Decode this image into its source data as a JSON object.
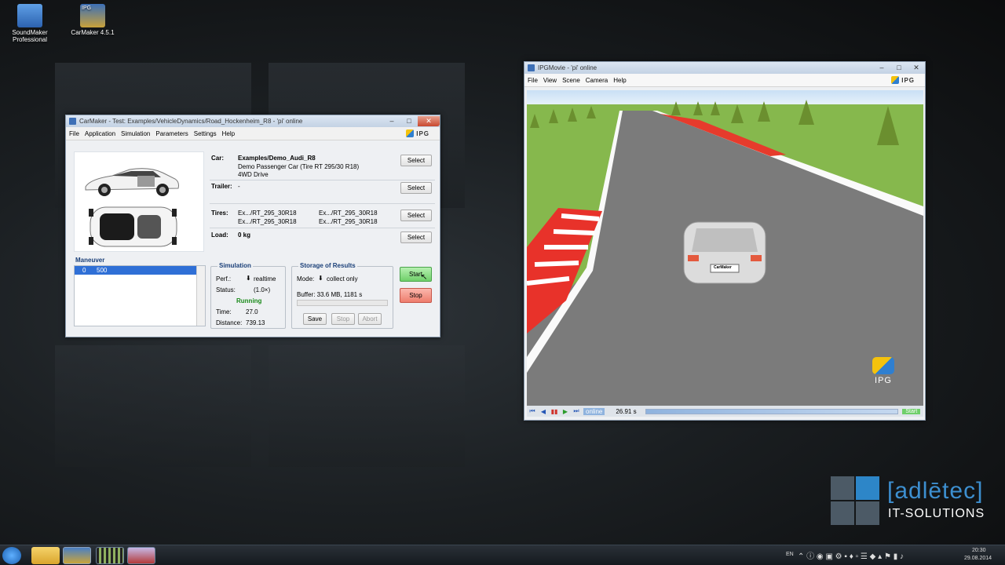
{
  "desktop": {
    "icons": [
      {
        "label": "SoundMaker Professional"
      },
      {
        "label": "CarMaker 4.5.1",
        "badge": "IPG"
      }
    ]
  },
  "carmaker": {
    "title": "CarMaker - Test: Examples/VehicleDynamics/Road_Hockenheim_R8 - 'pi' online",
    "menu": [
      "File",
      "Application",
      "Simulation",
      "Parameters",
      "Settings",
      "Help"
    ],
    "logo": "IPG",
    "car": {
      "label": "Car:",
      "name": "Examples/Demo_Audi_R8",
      "line2": "Demo Passenger Car (Tire RT 295/30 R18)",
      "line3": "4WD Drive",
      "button": "Select"
    },
    "trailer": {
      "label": "Trailer:",
      "value": "-",
      "button": "Select"
    },
    "tires": {
      "label": "Tires:",
      "values": [
        "Ex.../RT_295_30R18",
        "Ex.../RT_295_30R18",
        "Ex.../RT_295_30R18",
        "Ex.../RT_295_30R18"
      ],
      "button": "Select"
    },
    "load": {
      "label": "Load:",
      "value": "0 kg",
      "button": "Select"
    },
    "maneuver": {
      "title": "Maneuver",
      "rows": [
        {
          "idx": "0",
          "value": "500"
        }
      ]
    },
    "simulation": {
      "title": "Simulation",
      "perf_label": "Perf.:",
      "perf_value": "realtime",
      "status_label": "Status:",
      "status_value": "(1.0×)",
      "running": "Running",
      "time_label": "Time:",
      "time_value": "27.0",
      "distance_label": "Distance:",
      "distance_value": "739.13"
    },
    "storage": {
      "title": "Storage of Results",
      "mode_label": "Mode:",
      "mode_value": "collect only",
      "buffer": "Buffer: 33.6 MB, 1181 s",
      "save": "Save",
      "stop": "Stop",
      "abort": "Abort"
    },
    "start": "Start",
    "stop": "Stop"
  },
  "ipgmovie": {
    "title": "IPGMovie - 'pi' online",
    "menu": [
      "File",
      "View",
      "Scene",
      "Camera",
      "Help"
    ],
    "logo": "IPG",
    "scene_logo": "IPG",
    "plate": "CarMaker",
    "mode": "online",
    "time": "26.91  s",
    "start": "Start"
  },
  "watermark": {
    "brand": "[adlētec]",
    "sub": "IT-SOLUTIONS"
  },
  "taskbar": {
    "lang": "EN",
    "time": "20:30",
    "date": "29.08.2014"
  },
  "colors": {
    "accent": "#3a78d6",
    "start_green": "#7fd37f",
    "stop_red": "#f08a7e",
    "running": "#1a8a1a"
  }
}
